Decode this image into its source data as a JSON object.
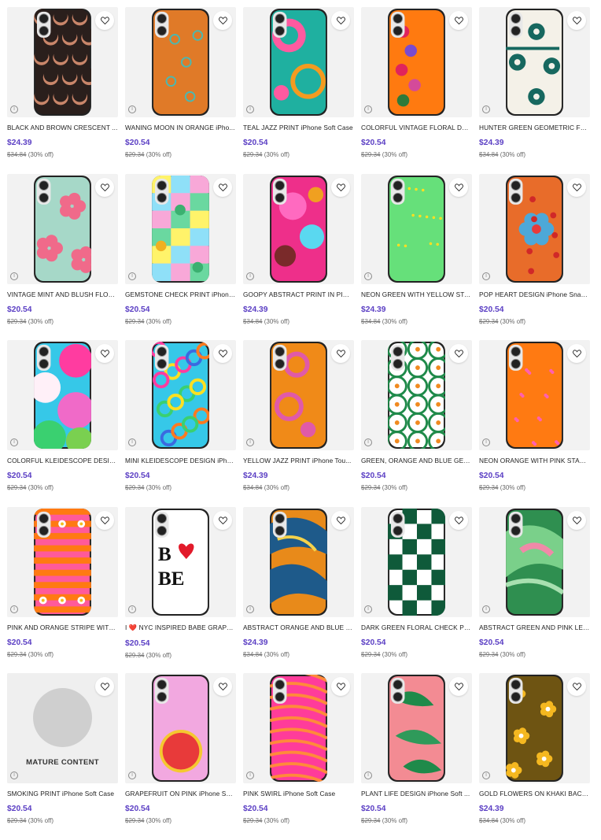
{
  "products": [
    {
      "title": "BLACK AND BROWN CRESCENT ...",
      "price": "$24.39",
      "original": "$34.84",
      "discount": "(30% off)",
      "art": "crescent",
      "bg": "#2a1f1c"
    },
    {
      "title": "WANING MOON IN ORANGE iPho...",
      "price": "$20.54",
      "original": "$29.34",
      "discount": "(30% off)",
      "art": "moon",
      "bg": "#e07a28"
    },
    {
      "title": "TEAL JAZZ PRINT iPhone Soft Case",
      "price": "$20.54",
      "original": "$29.34",
      "discount": "(30% off)",
      "art": "tealjazz",
      "bg": "#1fb0a0"
    },
    {
      "title": "COLORFUL VINTAGE FLORAL DES...",
      "price": "$20.54",
      "original": "$29.34",
      "discount": "(30% off)",
      "art": "vintagefloral",
      "bg": "#ff7a10"
    },
    {
      "title": "HUNTER GREEN GEOMETRIC FLO...",
      "price": "$24.39",
      "original": "$34.84",
      "discount": "(30% off)",
      "art": "huntergreen",
      "bg": "#f4f1e8"
    },
    {
      "title": "VINTAGE MINT AND BLUSH FLOR...",
      "price": "$20.54",
      "original": "$29.34",
      "discount": "(30% off)",
      "art": "mintblush",
      "bg": "#a6d8c8"
    },
    {
      "title": "GEMSTONE CHECK PRINT iPhone...",
      "price": "$20.54",
      "original": "$29.34",
      "discount": "(30% off)",
      "art": "gemstone",
      "bg": "#f8a8d8"
    },
    {
      "title": "GOOPY ABSTRACT PRINT IN PINK...",
      "price": "$24.39",
      "original": "$34.84",
      "discount": "(30% off)",
      "art": "goopy",
      "bg": "#ee2f8a"
    },
    {
      "title": "NEON GREEN WITH YELLOW STA...",
      "price": "$24.39",
      "original": "$34.84",
      "discount": "(30% off)",
      "art": "neongreen",
      "bg": "#66e07a"
    },
    {
      "title": "POP HEART DESIGN iPhone Snap ...",
      "price": "$20.54",
      "original": "$29.34",
      "discount": "(30% off)",
      "art": "popheart",
      "bg": "#e86c2a"
    },
    {
      "title": "COLORFUL KLEIDESCOPE DESIG...",
      "price": "$20.54",
      "original": "$29.34",
      "discount": "(30% off)",
      "art": "kaleido",
      "bg": "#36c8e8"
    },
    {
      "title": "MINI KLEIDESCOPE DESIGN iPhon...",
      "price": "$20.54",
      "original": "$29.34",
      "discount": "(30% off)",
      "art": "minikaleido",
      "bg": "#36c8e8"
    },
    {
      "title": "YELLOW JAZZ PRINT iPhone Tou...",
      "price": "$24.39",
      "original": "$34.84",
      "discount": "(30% off)",
      "art": "yellowjazz",
      "bg": "#f08a18"
    },
    {
      "title": "GREEN, ORANGE AND BLUE GEO...",
      "price": "$20.54",
      "original": "$29.34",
      "discount": "(30% off)",
      "art": "greengeo",
      "bg": "#ffffff"
    },
    {
      "title": "NEON ORANGE WITH PINK STAR...",
      "price": "$20.54",
      "original": "$29.34",
      "discount": "(30% off)",
      "art": "neonorange",
      "bg": "#ff7a12"
    },
    {
      "title": "PINK AND ORANGE STRIPE WITH ...",
      "price": "$20.54",
      "original": "$29.34",
      "discount": "(30% off)",
      "art": "stripe",
      "bg": "#ff5a9a"
    },
    {
      "title": "I ❤️ NYC INSPIRED BABE GRAPHI...",
      "price": "$20.54",
      "original": "$29.34",
      "discount": "(30% off)",
      "art": "babe",
      "bg": "#ffffff"
    },
    {
      "title": "ABSTRACT ORANGE AND BLUE L...",
      "price": "$24.39",
      "original": "$34.84",
      "discount": "(30% off)",
      "art": "orangeblue",
      "bg": "#e88a1a"
    },
    {
      "title": "DARK GREEN FLORAL CHECK PRI...",
      "price": "$20.54",
      "original": "$29.34",
      "discount": "(30% off)",
      "art": "greencheck",
      "bg": "#ffffff"
    },
    {
      "title": "ABSTRACT GREEN AND PINK LEA...",
      "price": "$20.54",
      "original": "$29.34",
      "discount": "(30% off)",
      "art": "greenpink",
      "bg": "#2f8f50"
    },
    {
      "title": "SMOKING PRINT iPhone Soft Case",
      "price": "$20.54",
      "original": "$29.34",
      "discount": "(30% off)",
      "art": "mature",
      "bg": "#efefef",
      "mature_label": "MATURE CONTENT"
    },
    {
      "title": "GRAPEFRUIT ON PINK iPhone Sof...",
      "price": "$20.54",
      "original": "$29.34",
      "discount": "(30% off)",
      "art": "grapefruit",
      "bg": "#f2a8e0"
    },
    {
      "title": "PINK SWIRL iPhone Soft Case",
      "price": "$20.54",
      "original": "$29.34",
      "discount": "(30% off)",
      "art": "pinkswirl",
      "bg": "#ff3c9a"
    },
    {
      "title": "PLANT LIFE DESIGN iPhone Soft ...",
      "price": "$20.54",
      "original": "$29.34",
      "discount": "(30% off)",
      "art": "plant",
      "bg": "#f38b93"
    },
    {
      "title": "GOLD FLOWERS ON KHAKI BACK...",
      "price": "$24.39",
      "original": "$34.84",
      "discount": "(30% off)",
      "art": "gold",
      "bg": "#6e5412"
    }
  ],
  "colors": {
    "price": "#5b3fc4",
    "title": "#222222",
    "muted": "#666666"
  },
  "icons": {
    "favorite": "heart-outline-icon",
    "info": "info-circle-icon"
  }
}
